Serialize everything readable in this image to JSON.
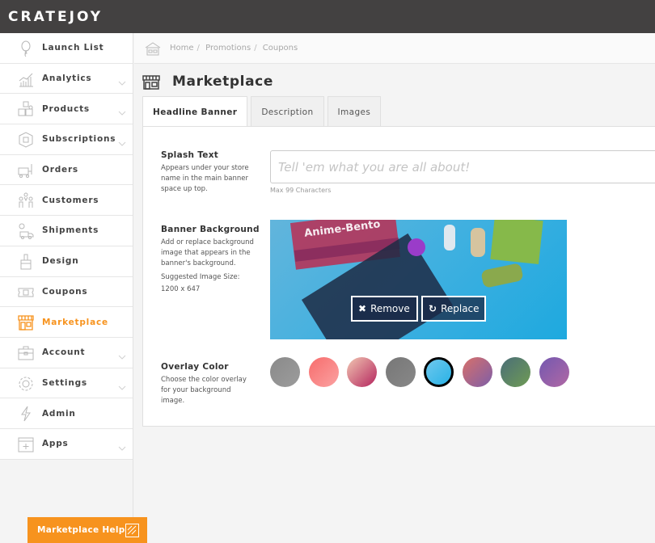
{
  "app": {
    "logo": "CRATEJOY"
  },
  "sidebar": {
    "items": [
      {
        "label": "Launch List",
        "icon": "balloon-icon",
        "has_chevron": false,
        "active": false
      },
      {
        "label": "Analytics",
        "icon": "chart-icon",
        "has_chevron": true,
        "active": false
      },
      {
        "label": "Products",
        "icon": "boxes-icon",
        "has_chevron": true,
        "active": false
      },
      {
        "label": "Subscriptions",
        "icon": "subscription-box-icon",
        "has_chevron": true,
        "active": false
      },
      {
        "label": "Orders",
        "icon": "cart-icon",
        "has_chevron": false,
        "active": false
      },
      {
        "label": "Customers",
        "icon": "people-icon",
        "has_chevron": false,
        "active": false
      },
      {
        "label": "Shipments",
        "icon": "truck-icon",
        "has_chevron": false,
        "active": false
      },
      {
        "label": "Design",
        "icon": "brush-icon",
        "has_chevron": false,
        "active": false
      },
      {
        "label": "Coupons",
        "icon": "ticket-icon",
        "has_chevron": false,
        "active": false
      },
      {
        "label": "Marketplace",
        "icon": "storefront-icon",
        "has_chevron": false,
        "active": true
      },
      {
        "label": "Account",
        "icon": "briefcase-icon",
        "has_chevron": true,
        "active": false
      },
      {
        "label": "Settings",
        "icon": "gear-icon",
        "has_chevron": true,
        "active": false
      },
      {
        "label": "Admin",
        "icon": "lightning-icon",
        "has_chevron": false,
        "active": false
      },
      {
        "label": "Apps",
        "icon": "apps-icon",
        "has_chevron": true,
        "active": false
      }
    ]
  },
  "breadcrumb": {
    "items": [
      "Home",
      "Promotions",
      "Coupons"
    ],
    "separator": "/"
  },
  "page": {
    "title": "Marketplace"
  },
  "tabs": [
    {
      "label": "Headline Banner",
      "active": true
    },
    {
      "label": "Description",
      "active": false
    },
    {
      "label": "Images",
      "active": false
    }
  ],
  "splash": {
    "label": "Splash Text",
    "description": "Appears under your store name in the main banner space up top.",
    "placeholder": "Tell 'em what you are all about!",
    "value": "",
    "hint": "Max 99 Characters"
  },
  "banner": {
    "label": "Banner Background",
    "description": "Add or replace background image that appears in the banner's background.",
    "size_label": "Suggested Image Size:",
    "size_value": "1200 x 647",
    "image_text": "Anime-Bento",
    "remove_label": "Remove",
    "replace_label": "Replace"
  },
  "overlay": {
    "label": "Overlay Color",
    "description": "Choose the color overlay for your background image.",
    "selected_index": 4,
    "swatches": [
      {
        "from": "#8a8a8a",
        "to": "#9c9c9c"
      },
      {
        "from": "#f76c6c",
        "to": "#fba2a2"
      },
      {
        "from": "#f1c7b2",
        "to": "#b4245d"
      },
      {
        "from": "#777777",
        "to": "#888888"
      },
      {
        "from": "#6ec8ee",
        "to": "#29b2e6"
      },
      {
        "from": "#d8706a",
        "to": "#7d5ea8"
      },
      {
        "from": "#4a6e78",
        "to": "#6f9b54"
      },
      {
        "from": "#7358b0",
        "to": "#b168a4"
      }
    ]
  },
  "help": {
    "label": "Marketplace Help"
  },
  "colors": {
    "accent": "#f7931e",
    "topbar": "#434141"
  }
}
